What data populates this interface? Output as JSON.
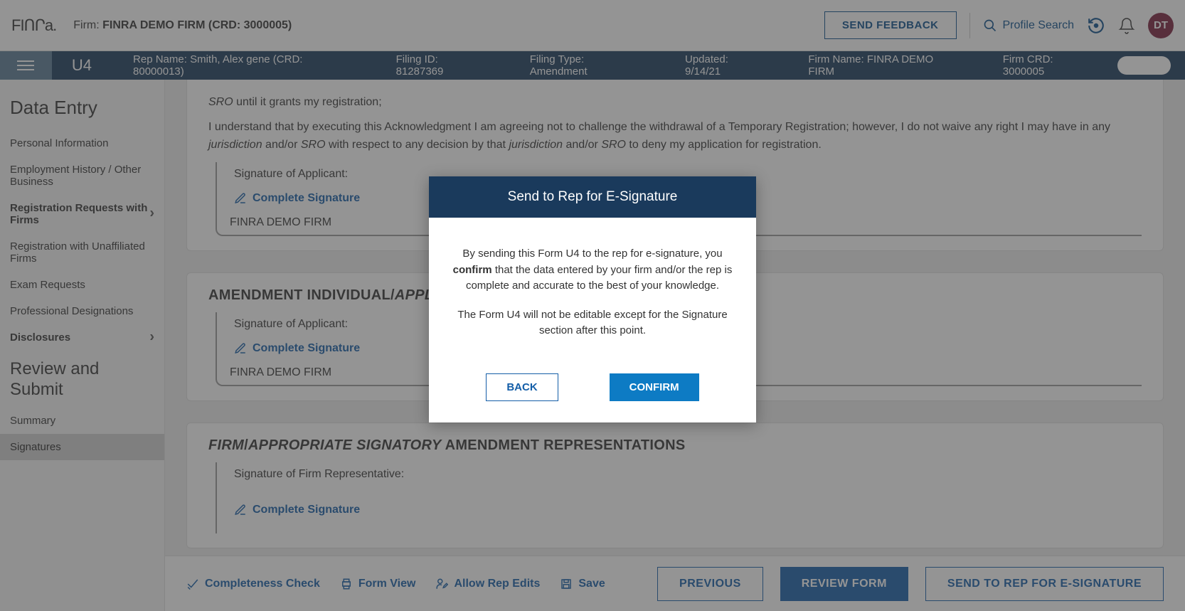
{
  "header": {
    "logo": "FIՈՐa.",
    "firm_prefix": "Firm: ",
    "firm_name": "FINRA DEMO FIRM (CRD: 3000005)",
    "feedback_btn": "SEND FEEDBACK",
    "profile_search": "Profile Search",
    "avatar": "DT"
  },
  "subheader": {
    "form_type": "U4",
    "rep_name_label": "Rep Name: ",
    "rep_name_value": "Smith, Alex gene (CRD: 80000013)",
    "filing_id_label": "Filing ID: ",
    "filing_id_value": "81287369",
    "filing_type_label": "Filing Type: ",
    "filing_type_value": "Amendment",
    "updated_label": "Updated: ",
    "updated_value": "9/14/21",
    "firm_name_label": "Firm Name: ",
    "firm_name_value": "FINRA DEMO FIRM",
    "firm_crd_label": "Firm CRD: ",
    "firm_crd_value": "3000005"
  },
  "sidebar": {
    "data_entry": "Data Entry",
    "items": [
      "Personal Information",
      "Employment History / Other Business",
      "Registration Requests with Firms",
      "Registration with Unaffiliated Firms",
      "Exam Requests",
      "Professional Designations",
      "Disclosures"
    ],
    "review_submit": "Review and Submit",
    "summary": "Summary",
    "signatures": "Signatures"
  },
  "body": {
    "para1_suffix": " until it grants my registration;",
    "sro1": "SRO",
    "para2_a": "I understand that by executing this Acknowledgment I am agreeing not to challenge the withdrawal of a Temporary Registration; however, I do not waive any right I may have in any ",
    "jurisdiction": "jurisdiction",
    "andor": " and/or ",
    "sro2": "SRO",
    "para2_b": " with respect to any decision by that ",
    "para2_c": " to deny my application for registration.",
    "sig_applicant": "Signature of Applicant:",
    "complete_sig": "Complete Signature",
    "demo_firm": "FINRA DEMO FIRM",
    "section2_a": "AMENDMENT INDIVIDUAL/",
    "section2_b": "APPLICA",
    "section3_a": "FIRM",
    "section3_slash": "/",
    "section3_b": "APPROPRIATE SIGNATORY",
    "section3_c": " AMENDMENT REPRESENTATIONS",
    "sig_firm_rep": "Signature of Firm Representative:"
  },
  "bottom": {
    "completeness": "Completeness Check",
    "form_view": "Form View",
    "allow_edits": "Allow Rep Edits",
    "save": "Save",
    "previous": "PREVIOUS",
    "review_form": "REVIEW FORM",
    "send_to_rep": "SEND TO REP FOR E-SIGNATURE"
  },
  "modal": {
    "title": "Send to Rep for E-Signature",
    "p1a": "By sending this Form U4 to the rep for e-signature, you ",
    "p1b": "confirm",
    "p1c": " that the data entered by your firm and/or the rep is complete and accurate to the best of your knowledge.",
    "p2": "The Form U4 will not be editable except for the Signature section after this point.",
    "back": "BACK",
    "confirm": "CONFIRM"
  }
}
